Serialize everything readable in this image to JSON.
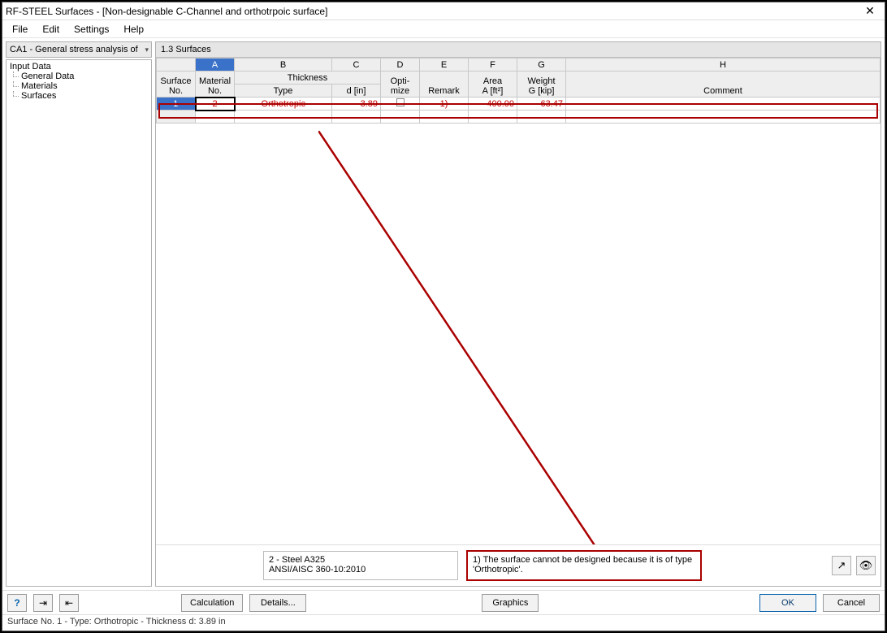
{
  "window": {
    "title": "RF-STEEL Surfaces - [Non-designable C-Channel and orthotrpoic surface]"
  },
  "menu": {
    "file": "File",
    "edit": "Edit",
    "settings": "Settings",
    "help": "Help"
  },
  "combo": {
    "text": "CA1 - General stress analysis of"
  },
  "tree": {
    "root": "Input Data",
    "n1": "General Data",
    "n2": "Materials",
    "n3": "Surfaces"
  },
  "panel": {
    "title": "1.3 Surfaces"
  },
  "columns": {
    "letters": {
      "A": "A",
      "B": "B",
      "C": "C",
      "D": "D",
      "E": "E",
      "F": "F",
      "G": "G",
      "H": "H"
    },
    "h_surface": "Surface",
    "h_material": "Material",
    "h_thickness": "Thickness",
    "h_opti": "Opti-",
    "h_area": "Area",
    "h_weight": "Weight",
    "s_no": "No.",
    "s_matno": "No.",
    "s_type": "Type",
    "s_d": "d [in]",
    "s_mize": "mize",
    "s_remark": "Remark",
    "s_aft2": "A [ft²]",
    "s_gkip": "G [kip]",
    "s_comment": "Comment"
  },
  "row1": {
    "surface_no": "1",
    "material_no": "2",
    "type": "Orthotropic",
    "d": "3.89",
    "remark": "1)",
    "area": "400.00",
    "weight": "63.47",
    "comment": ""
  },
  "info": {
    "line1": "2 - Steel A325",
    "line2": "ANSI/AISC 360-10:2010",
    "msg": "1) The surface cannot be designed because it is of type 'Orthotropic'."
  },
  "buttons": {
    "calculation": "Calculation",
    "details": "Details...",
    "graphics": "Graphics",
    "ok": "OK",
    "cancel": "Cancel"
  },
  "status": {
    "text": "Surface No. 1  -  Type: Orthotropic  -  Thickness d: 3.89 in"
  }
}
